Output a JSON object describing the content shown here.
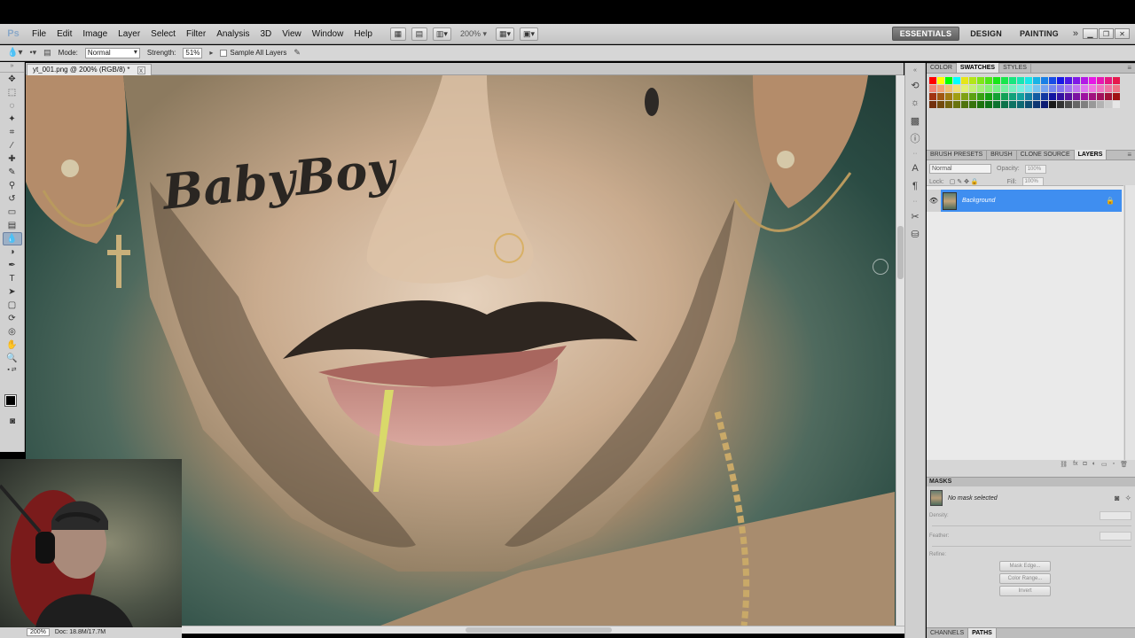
{
  "app": {
    "logo": "Ps",
    "menu": [
      "File",
      "Edit",
      "Image",
      "Layer",
      "Select",
      "Filter",
      "Analysis",
      "3D",
      "View",
      "Window",
      "Help"
    ],
    "zoom": "200%",
    "workspaces": [
      "ESSENTIALS",
      "DESIGN",
      "PAINTING"
    ],
    "workspaces_more": "»"
  },
  "options": {
    "mode_label": "Mode:",
    "mode_value": "Normal",
    "strength_label": "Strength:",
    "strength_value": "51%",
    "sample_label": "Sample All Layers"
  },
  "document": {
    "tab_title": "yt_001.png @ 200% (RGB/8) *",
    "tab_close": "x",
    "tattoo_text": "BabyBoy"
  },
  "status": {
    "zoom": "200%",
    "doc_info": "Doc: 18.8M/17.7M"
  },
  "panels": {
    "color_tabs": [
      "COLOR",
      "SWATCHES",
      "STYLES"
    ],
    "color_active": "SWATCHES",
    "layers_tabs": [
      "BRUSH PRESETS",
      "BRUSH",
      "CLONE SOURCE",
      "LAYERS"
    ],
    "layers_active": "LAYERS",
    "blend_mode": "Normal",
    "opacity_label": "Opacity:",
    "opacity_value": "100%",
    "lock_label": "Lock:",
    "fill_label": "Fill:",
    "fill_value": "100%",
    "layer_name": "Background",
    "masks_title": "MASKS",
    "no_mask": "No mask selected",
    "density_label": "Density:",
    "feather_label": "Feather:",
    "refine_label": "Refine:",
    "mask_edge": "Mask Edge...",
    "color_range": "Color Range...",
    "invert": "Invert",
    "bottom_tabs": [
      "CHANNELS",
      "PATHS"
    ],
    "bottom_active": "PATHS"
  },
  "colors": {
    "selection_blue": "#3f8ef0",
    "panel_gray": "#d6d6d6",
    "canvas_bg_green": "#2a4b43"
  }
}
